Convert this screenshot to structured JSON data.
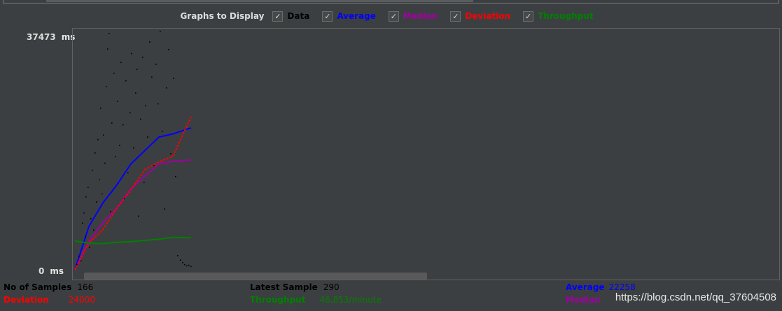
{
  "toolbar": {
    "label": "Graphs to Display",
    "checkboxes": [
      {
        "label": "Data",
        "color": "#000000",
        "checked": true
      },
      {
        "label": "Average",
        "color": "#0000ff",
        "checked": true
      },
      {
        "label": "Median",
        "color": "#a000a0",
        "checked": true
      },
      {
        "label": "Deviation",
        "color": "#ff0000",
        "checked": true
      },
      {
        "label": "Throughput",
        "color": "#008000",
        "checked": true
      }
    ],
    "check_glyph": "✓"
  },
  "axis": {
    "ymax_value": "37473",
    "ymin_value": "0",
    "unit": "ms"
  },
  "stats": {
    "samples_label": "No of Samples",
    "samples_value": "166",
    "latest_label": "Latest Sample",
    "latest_value": "290",
    "average_label": "Average",
    "average_value": "22258",
    "deviation_label": "Deviation",
    "deviation_value": "24000",
    "throughput_label": "Throughput",
    "throughput_value": "46.853/minute",
    "median_label": "Median",
    "median_value": ""
  },
  "watermark": "https://blog.csdn.net/qq_37604508",
  "chart_data": {
    "type": "line",
    "xlabel": "",
    "ylabel": "",
    "ylim": [
      0,
      37473
    ],
    "x": [
      0,
      20,
      40,
      60,
      80,
      100,
      120,
      140,
      166
    ],
    "series": [
      {
        "name": "Average",
        "color": "#0000ff",
        "values": [
          0,
          6800,
          10500,
          13300,
          16600,
          18700,
          20800,
          21300,
          22258
        ]
      },
      {
        "name": "Median",
        "color": "#a000a0",
        "values": [
          0,
          4500,
          7400,
          9700,
          12700,
          14700,
          16600,
          17000,
          17200
        ]
      },
      {
        "name": "Deviation",
        "color": "#ff0000",
        "values": [
          0,
          4200,
          6300,
          9700,
          12500,
          15700,
          16900,
          17800,
          24000
        ]
      },
      {
        "name": "Throughput",
        "color": "#008000",
        "values": [
          4500,
          4200,
          4100,
          4300,
          4400,
          4600,
          4800,
          5100,
          5000
        ]
      }
    ],
    "data_points": [
      [
        2,
        900
      ],
      [
        5,
        2200
      ],
      [
        8,
        1500
      ],
      [
        10,
        7400
      ],
      [
        12,
        9000
      ],
      [
        14,
        5200
      ],
      [
        15,
        11500
      ],
      [
        18,
        13000
      ],
      [
        20,
        3600
      ],
      [
        22,
        8100
      ],
      [
        24,
        15700
      ],
      [
        26,
        6300
      ],
      [
        28,
        18400
      ],
      [
        30,
        10700
      ],
      [
        32,
        20500
      ],
      [
        34,
        14200
      ],
      [
        36,
        25400
      ],
      [
        38,
        12000
      ],
      [
        40,
        21200
      ],
      [
        42,
        16800
      ],
      [
        44,
        28800
      ],
      [
        46,
        34700
      ],
      [
        48,
        37100
      ],
      [
        50,
        9200
      ],
      [
        52,
        23100
      ],
      [
        55,
        30900
      ],
      [
        57,
        17800
      ],
      [
        60,
        26500
      ],
      [
        63,
        19600
      ],
      [
        65,
        32600
      ],
      [
        68,
        22800
      ],
      [
        70,
        11300
      ],
      [
        72,
        29700
      ],
      [
        75,
        15300
      ],
      [
        78,
        24700
      ],
      [
        80,
        34000
      ],
      [
        83,
        19200
      ],
      [
        86,
        27800
      ],
      [
        88,
        31500
      ],
      [
        90,
        8500
      ],
      [
        93,
        23700
      ],
      [
        96,
        33400
      ],
      [
        98,
        13800
      ],
      [
        100,
        25800
      ],
      [
        103,
        20900
      ],
      [
        106,
        35800
      ],
      [
        109,
        30300
      ],
      [
        112,
        16400
      ],
      [
        115,
        32300
      ],
      [
        118,
        26100
      ],
      [
        121,
        37473
      ],
      [
        124,
        21800
      ],
      [
        127,
        9600
      ],
      [
        130,
        28600
      ],
      [
        133,
        34600
      ],
      [
        136,
        18300
      ],
      [
        140,
        30100
      ],
      [
        143,
        14700
      ],
      [
        146,
        2300
      ],
      [
        150,
        1600
      ],
      [
        153,
        1200
      ],
      [
        156,
        900
      ],
      [
        159,
        700
      ],
      [
        162,
        800
      ],
      [
        165,
        600
      ]
    ]
  }
}
